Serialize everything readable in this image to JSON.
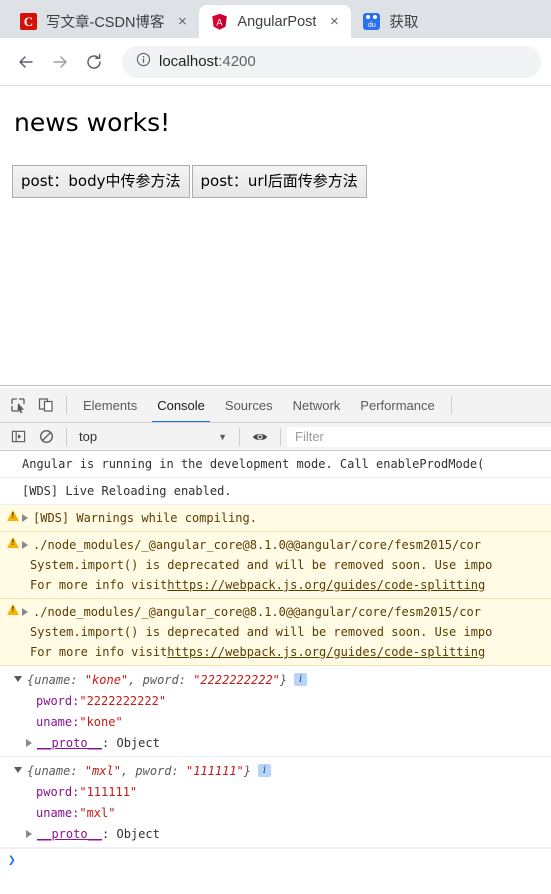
{
  "browser": {
    "tabs": [
      {
        "title": "写文章-CSDN博客",
        "favicon": "csdn-icon",
        "active": false,
        "close": "×"
      },
      {
        "title": "AngularPost",
        "favicon": "angular-icon",
        "active": true,
        "close": "×"
      },
      {
        "title": "获取",
        "favicon": "baidu-icon",
        "active": false,
        "close": "×"
      }
    ],
    "nav": {
      "back": "back-icon",
      "forward": "forward-icon",
      "reload": "reload-icon"
    },
    "omnibox": {
      "info_icon": "info-circle-icon",
      "url_host": "localhost",
      "url_rest": ":4200"
    }
  },
  "page": {
    "heading": "news works!",
    "buttons": [
      "post：body中传参方法",
      "post：url后面传参方法"
    ]
  },
  "devtools": {
    "toolbar_icons": [
      "inspect-element-icon",
      "device-toolbar-icon"
    ],
    "tabs": [
      {
        "label": "Elements",
        "active": false
      },
      {
        "label": "Console",
        "active": true
      },
      {
        "label": "Sources",
        "active": false
      },
      {
        "label": "Network",
        "active": false
      },
      {
        "label": "Performance",
        "active": false
      }
    ],
    "filterbar": {
      "sidebar_icon": "console-sidebar-icon",
      "clear_icon": "clear-console-icon",
      "context": "top",
      "caret": "▼",
      "eye_icon": "live-expression-eye-icon",
      "filter_placeholder": "Filter"
    },
    "console": {
      "messages": [
        {
          "level": "log",
          "lines": [
            {
              "text": "Angular is running in the development mode. Call enableProdMode("
            }
          ]
        },
        {
          "level": "log",
          "lines": [
            {
              "text": "[WDS] Live Reloading enabled."
            }
          ]
        },
        {
          "level": "warning",
          "lines": [
            {
              "text": "[WDS] Warnings while compiling."
            }
          ]
        },
        {
          "level": "warning",
          "lines": [
            {
              "text": "./node_modules/_@angular_core@8.1.0@@angular/core/fesm2015/cor"
            },
            {
              "text": "System.import() is deprecated and will be removed soon. Use impo"
            },
            {
              "text": "For more info visit ",
              "link": "https://webpack.js.org/guides/code-splitting"
            }
          ]
        },
        {
          "level": "warning",
          "lines": [
            {
              "text": "./node_modules/_@angular_core@8.1.0@@angular/core/fesm2015/cor"
            },
            {
              "text": "System.import() is deprecated and will be removed soon. Use impo"
            },
            {
              "text": "For more info visit ",
              "link": "https://webpack.js.org/guides/code-splitting"
            }
          ]
        }
      ],
      "objects": [
        {
          "preview_open": "{",
          "preview_close": "}",
          "preview_pairs": [
            {
              "key": "uname: ",
              "value": "\"kone\"",
              "sep": ", "
            },
            {
              "key": "pword: ",
              "value": "\"2222222222\"",
              "sep": ""
            }
          ],
          "badge": "i",
          "props": [
            {
              "name": "pword: ",
              "value": "\"2222222222\""
            },
            {
              "name": "uname: ",
              "value": "\"kone\""
            }
          ],
          "proto_name": "__proto__",
          "proto_value": ": Object"
        },
        {
          "preview_open": "{",
          "preview_close": "}",
          "preview_pairs": [
            {
              "key": "uname: ",
              "value": "\"mxl\"",
              "sep": ", "
            },
            {
              "key": "pword: ",
              "value": "\"111111\"",
              "sep": ""
            }
          ],
          "badge": "i",
          "props": [
            {
              "name": "pword: ",
              "value": "\"111111\""
            },
            {
              "name": "uname: ",
              "value": "\"mxl\""
            }
          ],
          "proto_name": "__proto__",
          "proto_value": ": Object"
        }
      ],
      "prompt_caret": "❯"
    }
  }
}
